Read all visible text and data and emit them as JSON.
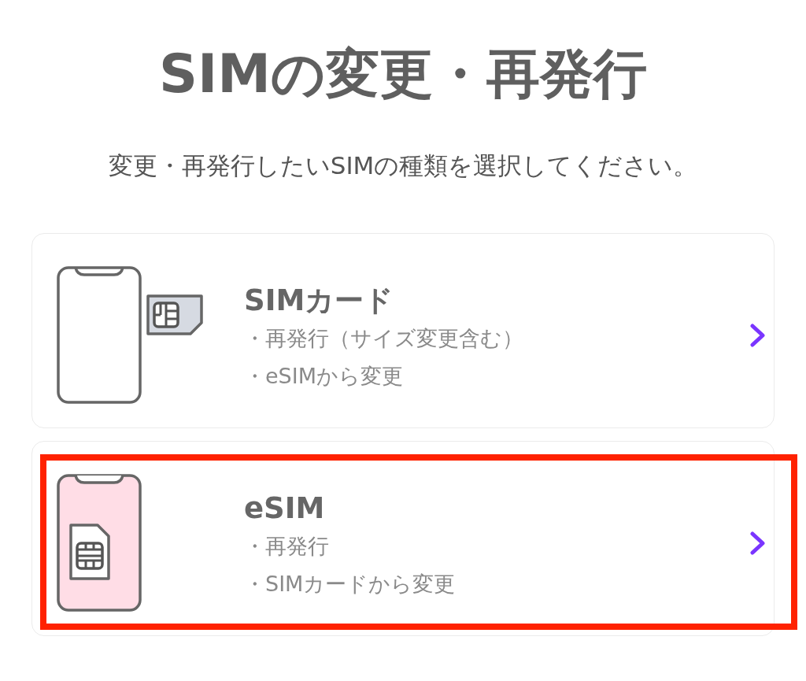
{
  "page": {
    "title": "SIMの変更・再発行",
    "instruction": "変更・再発行したいSIMの種類を選択してください。"
  },
  "options": [
    {
      "kind": "sim_card",
      "title": "SIMカード",
      "lines": [
        "・再発行（サイズ変更含む）",
        "・eSIMから変更"
      ],
      "highlighted": false
    },
    {
      "kind": "esim",
      "title": "eSIM",
      "lines": [
        "・再発行",
        "・SIMカードから変更"
      ],
      "highlighted": true
    }
  ]
}
